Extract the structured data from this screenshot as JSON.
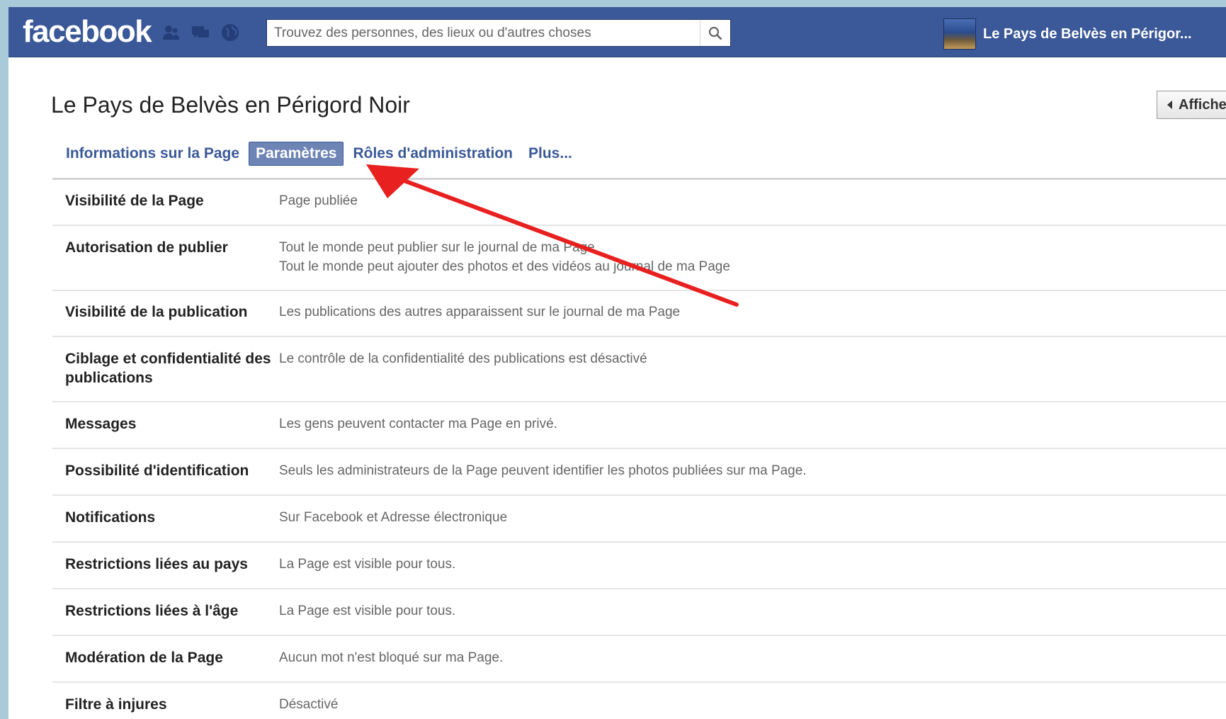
{
  "topbar": {
    "logo": "facebook",
    "search_placeholder": "Trouvez des personnes, des lieux ou d'autres choses",
    "profile_name": "Le Pays de Belvès en Périgor..."
  },
  "page": {
    "title": "Le Pays de Belvès en Périgord Noir",
    "view_button": "Affiche"
  },
  "tabs": [
    {
      "label": "Informations sur la Page"
    },
    {
      "label": "Paramètres"
    },
    {
      "label": "Rôles d'administration"
    },
    {
      "label": "Plus..."
    }
  ],
  "settings": [
    {
      "label": "Visibilité de la Page",
      "values": [
        "Page publiée"
      ]
    },
    {
      "label": "Autorisation de publier",
      "values": [
        "Tout le monde peut publier sur le journal de ma Page",
        "Tout le monde peut ajouter des photos et des vidéos au journal de ma Page"
      ]
    },
    {
      "label": "Visibilité de la publication",
      "values": [
        "Les publications des autres apparaissent sur le journal de ma Page"
      ]
    },
    {
      "label": "Ciblage et confidentialité des publications",
      "values": [
        "Le contrôle de la confidentialité des publications est désactivé"
      ]
    },
    {
      "label": "Messages",
      "values": [
        "Les gens peuvent contacter ma Page en privé."
      ]
    },
    {
      "label": "Possibilité d'identification",
      "values": [
        "Seuls les administrateurs de la Page peuvent identifier les photos publiées sur ma Page."
      ]
    },
    {
      "label": "Notifications",
      "values": [
        "Sur Facebook et Adresse électronique"
      ]
    },
    {
      "label": "Restrictions liées au pays",
      "values": [
        "La Page est visible pour tous."
      ]
    },
    {
      "label": "Restrictions liées à l'âge",
      "values": [
        "La Page est visible pour tous."
      ]
    },
    {
      "label": "Modération de la Page",
      "values": [
        "Aucun mot n'est bloqué sur ma Page."
      ]
    },
    {
      "label": "Filtre à injures",
      "values": [
        "Désactivé"
      ]
    }
  ],
  "colors": {
    "brand": "#3b5998",
    "active_tab": "#6d84b4",
    "annotation_arrow": "#e8201f"
  }
}
